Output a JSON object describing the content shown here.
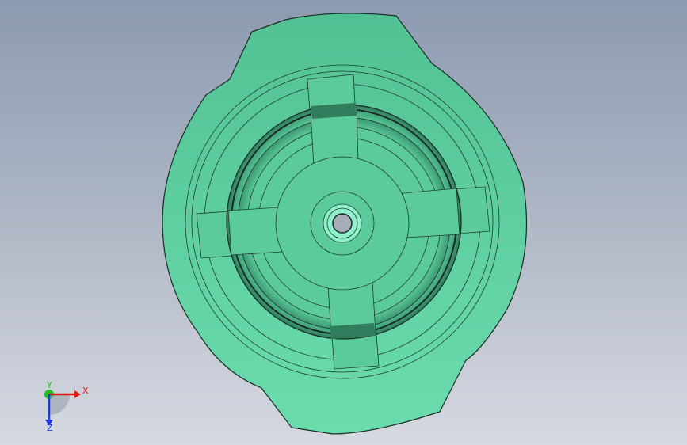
{
  "viewport": {
    "background_top": "#8c9ab1",
    "background_bottom": "#d6d9e1"
  },
  "model": {
    "face_color": "#5ccb9c",
    "face_color_light": "#6bd9aa",
    "edge_color": "#1a2a22",
    "hub_color": "#8ff0cc"
  },
  "triad": {
    "x_label": "X",
    "y_label": "Y",
    "z_label": "Z",
    "x_color": "#e01818",
    "y_color": "#22c022",
    "z_color": "#1a3adc"
  }
}
